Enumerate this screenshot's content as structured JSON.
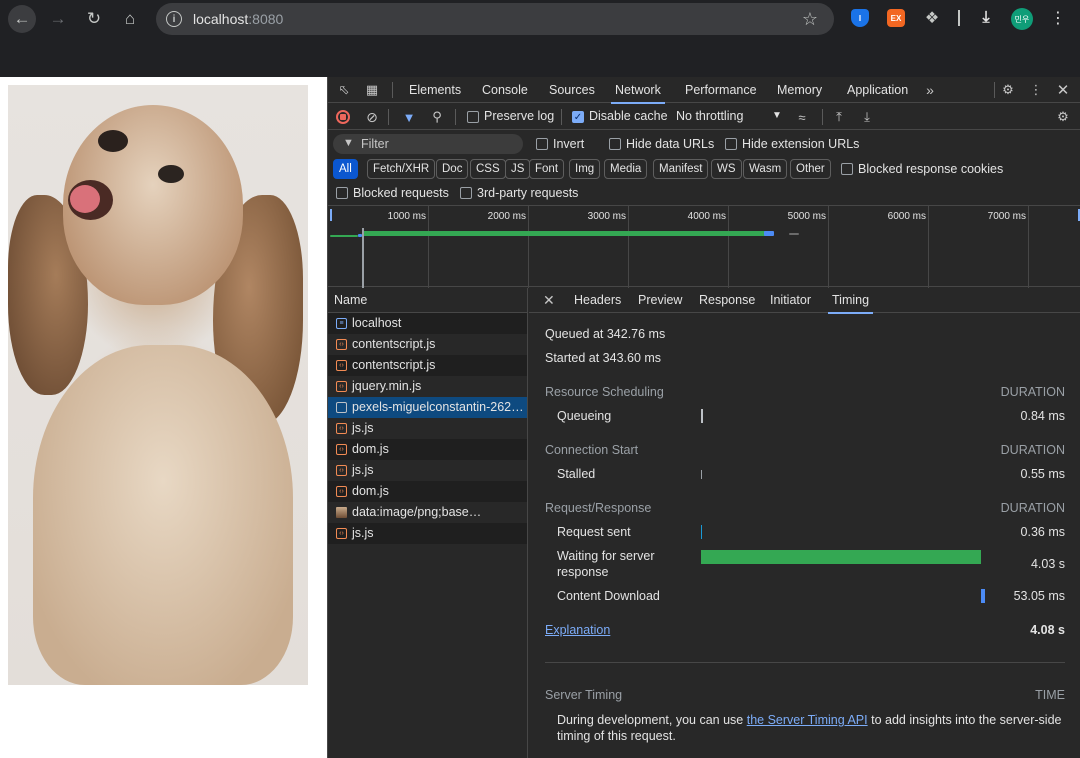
{
  "browser": {
    "url_host": "localhost",
    "url_port": ":8080",
    "avatar_text": "민우",
    "ext_orange_text": "EX"
  },
  "devtools": {
    "tabs": [
      "Elements",
      "Console",
      "Sources",
      "Network",
      "Performance",
      "Memory",
      "Application"
    ],
    "active_tab": "Network",
    "toolbar": {
      "preserve_log": "Preserve log",
      "disable_cache": "Disable cache",
      "throttling": "No throttling"
    },
    "filter": {
      "placeholder": "Filter",
      "invert": "Invert",
      "hide_data_urls": "Hide data URLs",
      "hide_extension_urls": "Hide extension URLs",
      "chips": [
        "All",
        "Fetch/XHR",
        "Doc",
        "CSS",
        "JS",
        "Font",
        "Img",
        "Media",
        "Manifest",
        "WS",
        "Wasm",
        "Other"
      ],
      "blocked_response_cookies": "Blocked response cookies",
      "blocked_requests": "Blocked requests",
      "third_party_requests": "3rd-party requests"
    },
    "timeline": {
      "ticks": [
        "1000 ms",
        "2000 ms",
        "3000 ms",
        "4000 ms",
        "5000 ms",
        "6000 ms",
        "7000 ms"
      ]
    },
    "requests": {
      "header": "Name",
      "rows": [
        {
          "name": "localhost",
          "type": "doc"
        },
        {
          "name": "contentscript.js",
          "type": "script"
        },
        {
          "name": "contentscript.js",
          "type": "script"
        },
        {
          "name": "jquery.min.js",
          "type": "script"
        },
        {
          "name": "pexels-miguelconstantin-262…",
          "type": "img",
          "selected": true
        },
        {
          "name": "js.js",
          "type": "script"
        },
        {
          "name": "dom.js",
          "type": "script"
        },
        {
          "name": "js.js",
          "type": "script"
        },
        {
          "name": "dom.js",
          "type": "script"
        },
        {
          "name": "data:image/png;base…",
          "type": "data"
        },
        {
          "name": "js.js",
          "type": "script"
        }
      ]
    },
    "detail": {
      "tabs": [
        "Headers",
        "Preview",
        "Response",
        "Initiator",
        "Timing"
      ],
      "active_tab": "Timing",
      "queued_at": "Queued at 342.76 ms",
      "started_at": "Started at 343.60 ms",
      "sections": {
        "resource_scheduling": "Resource Scheduling",
        "connection_start": "Connection Start",
        "request_response": "Request/Response",
        "duration": "DURATION"
      },
      "rows": {
        "queueing": {
          "label": "Queueing",
          "value": "0.84 ms"
        },
        "stalled": {
          "label": "Stalled",
          "value": "0.55 ms"
        },
        "request_sent": {
          "label": "Request sent",
          "value": "0.36 ms"
        },
        "waiting": {
          "label_1": "Waiting for server",
          "label_2": "response",
          "value": "4.03 s"
        },
        "content_download": {
          "label": "Content Download",
          "value": "53.05 ms"
        }
      },
      "explanation": "Explanation",
      "total": "4.08 s",
      "server_timing": {
        "title": "Server Timing",
        "time": "TIME",
        "text_1": "During development, you can use",
        "link": "the Server Timing API",
        "text_2": "to add insights into the server-side",
        "text_3": "timing of this request."
      }
    }
  },
  "colors": {
    "waiting_bar": "#34a853",
    "download_bar": "#4c8bf5",
    "accent": "#7cacf8"
  }
}
